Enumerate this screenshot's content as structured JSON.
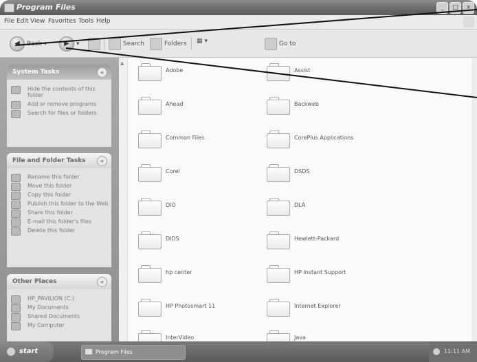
{
  "window": {
    "title": "Program Files"
  },
  "window_controls": {
    "minimize": "_",
    "maximize": "□",
    "close": "x"
  },
  "menu": [
    "File",
    "Edit",
    "View",
    "Favorites",
    "Tools",
    "Help"
  ],
  "toolbar": {
    "back_label": "Back",
    "search_label": "Search",
    "folders_label": "Folders",
    "views_label": "▦",
    "go_label": "Go to",
    "dropdown_glyph": "▾",
    "back_glyph": "◀",
    "forward_glyph": "▶"
  },
  "left_panels": {
    "system_tasks": {
      "title": "System Tasks",
      "items": [
        "Hide the contents of this folder",
        "Add or remove programs",
        "Search for files or folders"
      ]
    },
    "file_folder_tasks": {
      "title": "File and Folder Tasks",
      "items": [
        "Rename this folder",
        "Move this folder",
        "Copy this folder",
        "Publish this folder to the Web",
        "Share this folder",
        "E-mail this folder's files",
        "Delete this folder"
      ]
    },
    "other_places": {
      "title": "Other Places",
      "items": [
        "HP_PAVILION (C:)",
        "My Documents",
        "Shared Documents",
        "My Computer"
      ]
    },
    "collapse_glyph": "«"
  },
  "folders": {
    "left_column": [
      "Adobe",
      "Ahead",
      "Common Files",
      "Corel",
      "DIO",
      "DIDS",
      "hp center",
      "HP Photosmart 11",
      "InterVideo"
    ],
    "right_column": [
      "Assist",
      "Backweb",
      "CorePlus Applications",
      "DSDS",
      "DLA",
      "Hewlett-Packard",
      "HP Instant Support",
      "Internet Explorer",
      "Java"
    ]
  },
  "taskbar": {
    "start_label": "start",
    "task_label": "Program Files",
    "clock": "11:11 AM"
  }
}
